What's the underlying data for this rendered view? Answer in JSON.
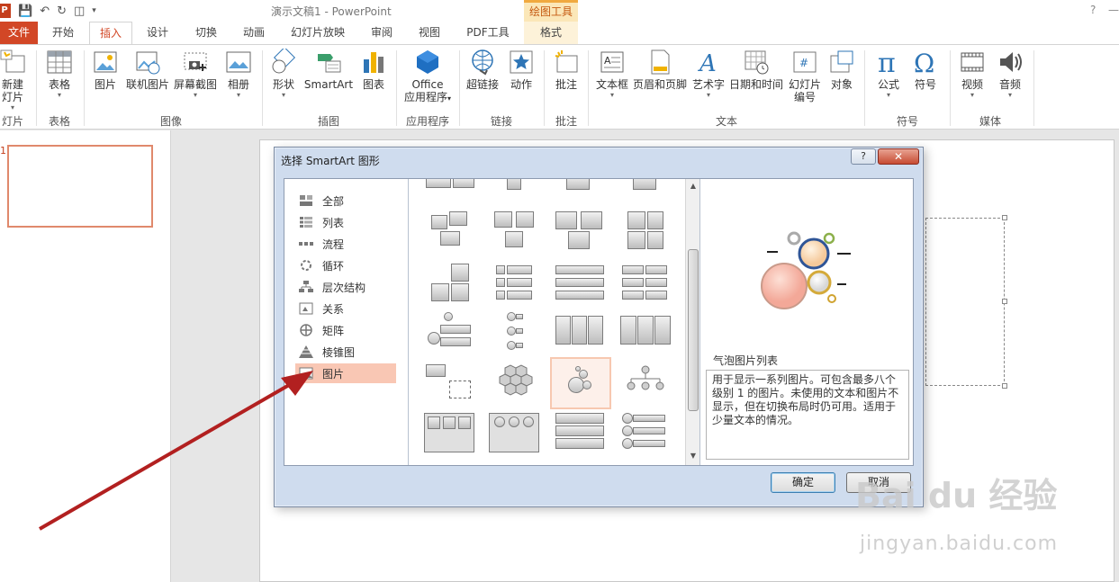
{
  "titlebar": {
    "document_title": "演示文稿1 - PowerPoint",
    "drawing_tools": "绘图工具",
    "help": "?"
  },
  "ribbon_tabs": [
    "文件",
    "开始",
    "插入",
    "设计",
    "切换",
    "动画",
    "幻灯片放映",
    "审阅",
    "视图",
    "PDF工具",
    "格式"
  ],
  "ribbon": {
    "buttons": {
      "new_slide": "新建\n灯片",
      "table": "表格",
      "picture": "图片",
      "online_picture": "联机图片",
      "screenshot": "屏幕截图",
      "album": "相册",
      "shapes": "形状",
      "smartart": "SmartArt",
      "chart": "图表",
      "office_apps_1": "Office",
      "office_apps_2": "应用程序",
      "hyperlink": "超链接",
      "action": "动作",
      "comment": "批注",
      "textbox": "文本框",
      "header_footer": "页眉和页脚",
      "wordart": "艺术字",
      "datetime": "日期和时间",
      "slide_number_1": "幻灯片",
      "slide_number_2": "编号",
      "object": "对象",
      "equation": "公式",
      "symbol": "符号",
      "video": "视频",
      "audio": "音频"
    },
    "groups": {
      "slides": "灯片",
      "tables": "表格",
      "images": "图像",
      "illustrations": "插图",
      "apps": "应用程序",
      "links": "链接",
      "comments": "批注",
      "text": "文本",
      "symbols": "符号",
      "media": "媒体"
    }
  },
  "dialog": {
    "title": "选择 SmartArt 图形",
    "help_label": "?",
    "close_label": "✕",
    "categories": [
      {
        "label": "全部",
        "icon": "all-icon"
      },
      {
        "label": "列表",
        "icon": "list-icon"
      },
      {
        "label": "流程",
        "icon": "process-icon"
      },
      {
        "label": "循环",
        "icon": "cycle-icon"
      },
      {
        "label": "层次结构",
        "icon": "hierarchy-icon"
      },
      {
        "label": "关系",
        "icon": "relationship-icon"
      },
      {
        "label": "矩阵",
        "icon": "matrix-icon"
      },
      {
        "label": "棱锥图",
        "icon": "pyramid-icon"
      },
      {
        "label": "图片",
        "icon": "picture-icon"
      }
    ],
    "selected_category": "图片",
    "preview_name": "气泡图片列表",
    "preview_description": "用于显示一系列图片。可包含最多八个级别 1 的图片。未使用的文本和图片不显示，但在切换布局时仍可用。适用于少量文本的情况。",
    "ok_label": "确定",
    "cancel_label": "取消"
  },
  "watermark": {
    "line1": "Bai du 经验",
    "line2": "jingyan.baidu.com"
  },
  "colors": {
    "file_tab": "#d24726",
    "accent": "#d24726",
    "selected_category": "#f9c7b4",
    "arrow": "#b22020"
  }
}
